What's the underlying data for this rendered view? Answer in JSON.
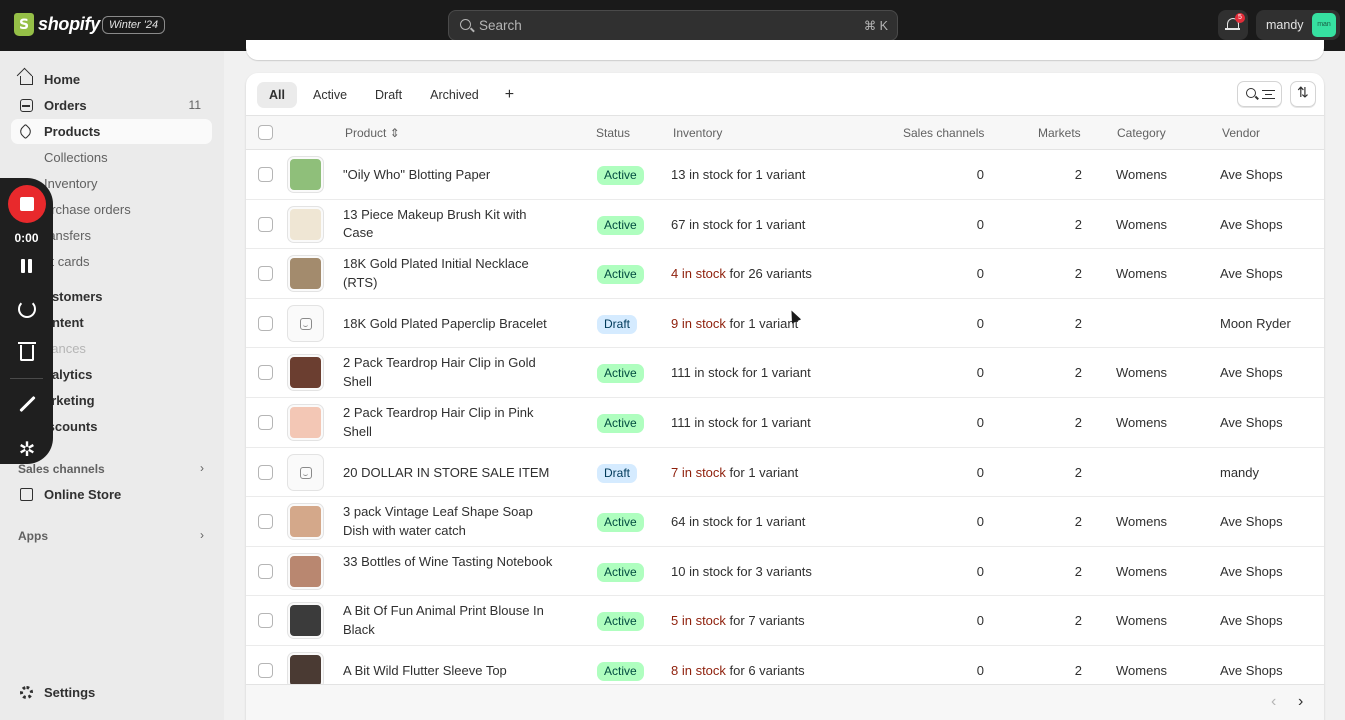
{
  "topbar": {
    "brand": "shopify",
    "edition": "Winter '24",
    "search_placeholder": "Search",
    "search_shortcut": "⌘ K",
    "notification_count": "5",
    "user_name": "mandy",
    "avatar_initials": "man"
  },
  "sidebar": {
    "home": "Home",
    "orders": "Orders",
    "orders_count": "11",
    "products": "Products",
    "collections": "Collections",
    "inventory": "Inventory",
    "purchase_orders": "urchase orders",
    "transfers": "ransfers",
    "gift_cards": "ift cards",
    "customers": "ustomers",
    "content": "ontent",
    "finances": "nances",
    "analytics": "nalytics",
    "marketing": "arketing",
    "discounts": "iscounts",
    "sales_channels": "Sales channels",
    "online_store": "Online Store",
    "apps": "Apps",
    "settings": "Settings"
  },
  "recorder": {
    "time": "0:00"
  },
  "tabs": [
    "All",
    "Active",
    "Draft",
    "Archived",
    "+"
  ],
  "columns": {
    "product": "Product",
    "status": "Status",
    "inventory": "Inventory",
    "sales_channels": "Sales channels",
    "markets": "Markets",
    "category": "Category",
    "vendor": "Vendor"
  },
  "rows": [
    {
      "name": "\"Oily Who\" Blotting Paper",
      "status": "Active",
      "inv_stock": "13 in stock",
      "inv_rest": " for 1 variant",
      "low": false,
      "channels": "0",
      "markets": "2",
      "category": "Womens",
      "vendor": "Ave Shops",
      "thumb": "#8fbf7a"
    },
    {
      "name": "13 Piece Makeup Brush Kit with Case",
      "status": "Active",
      "inv_stock": "67 in stock",
      "inv_rest": " for 1 variant",
      "low": false,
      "channels": "0",
      "markets": "2",
      "category": "Womens",
      "vendor": "Ave Shops",
      "thumb": "#efe6d4"
    },
    {
      "name": "18K Gold Plated Initial Necklace (RTS)",
      "status": "Active",
      "inv_stock": "4 in stock",
      "inv_rest": " for 26 variants",
      "low": true,
      "channels": "0",
      "markets": "2",
      "category": "Womens",
      "vendor": "Ave Shops",
      "thumb": "#a38b6d"
    },
    {
      "name": "18K Gold Plated Paperclip Bracelet",
      "status": "Draft",
      "inv_stock": "9 in stock",
      "inv_rest": " for 1 variant",
      "low": true,
      "channels": "0",
      "markets": "2",
      "category": "",
      "vendor": "Moon Ryder",
      "thumb": ""
    },
    {
      "name": "2 Pack Teardrop Hair Clip in Gold Shell",
      "status": "Active",
      "inv_stock": "111 in stock",
      "inv_rest": " for 1 variant",
      "low": false,
      "channels": "0",
      "markets": "2",
      "category": "Womens",
      "vendor": "Ave Shops",
      "thumb": "#6b3e30"
    },
    {
      "name": "2 Pack Teardrop Hair Clip in Pink Shell",
      "status": "Active",
      "inv_stock": "111 in stock",
      "inv_rest": " for 1 variant",
      "low": false,
      "channels": "0",
      "markets": "2",
      "category": "Womens",
      "vendor": "Ave Shops",
      "thumb": "#f3c7b5"
    },
    {
      "name": "20 DOLLAR IN STORE SALE ITEM",
      "status": "Draft",
      "inv_stock": "7 in stock",
      "inv_rest": " for 1 variant",
      "low": true,
      "channels": "0",
      "markets": "2",
      "category": "",
      "vendor": "mandy",
      "thumb": ""
    },
    {
      "name": "3 pack Vintage Leaf Shape Soap Dish with water catch",
      "status": "Active",
      "inv_stock": "64 in stock",
      "inv_rest": " for 1 variant",
      "low": false,
      "channels": "0",
      "markets": "2",
      "category": "Womens",
      "vendor": "Ave Shops",
      "thumb": "#d4a88a"
    },
    {
      "name": "33 Bottles of Wine Tasting Notebook",
      "status": "Active",
      "inv_stock": "10 in stock",
      "inv_rest": " for 3 variants",
      "low": false,
      "channels": "0",
      "markets": "2",
      "category": "Womens",
      "vendor": "Ave Shops",
      "thumb": "#b98770"
    },
    {
      "name": "A Bit Of Fun Animal Print Blouse In Black",
      "status": "Active",
      "inv_stock": "5 in stock",
      "inv_rest": " for 7 variants",
      "low": true,
      "channels": "0",
      "markets": "2",
      "category": "Womens",
      "vendor": "Ave Shops",
      "thumb": "#3b3b3b"
    },
    {
      "name": "A Bit Wild Flutter Sleeve Top",
      "status": "Active",
      "inv_stock": "8 in stock",
      "inv_rest": " for 6 variants",
      "low": true,
      "channels": "0",
      "markets": "2",
      "category": "Womens",
      "vendor": "Ave Shops",
      "thumb": "#4a3a33"
    }
  ]
}
